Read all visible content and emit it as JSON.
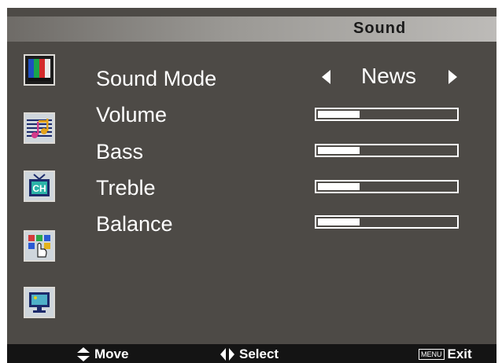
{
  "header": {
    "title": "Sound"
  },
  "sidebar": {
    "icons": [
      {
        "name": "picture-icon"
      },
      {
        "name": "sound-icon"
      },
      {
        "name": "channel-icon"
      },
      {
        "name": "function-icon"
      },
      {
        "name": "screen-icon"
      }
    ],
    "channel_icon_text": "CH"
  },
  "menu": {
    "sound_mode": {
      "label": "Sound Mode",
      "value": "News"
    },
    "volume": {
      "label": "Volume",
      "level": 0.3
    },
    "bass": {
      "label": "Bass",
      "level": 0.3
    },
    "treble": {
      "label": "Treble",
      "level": 0.3
    },
    "balance": {
      "label": "Balance",
      "level": 0.3
    }
  },
  "footer": {
    "move": "Move",
    "select": "Select",
    "menu_key": "MENU",
    "exit": "Exit"
  },
  "colors": {
    "background": "#4d4a46",
    "text": "#ffffff",
    "footer": "#141414"
  }
}
